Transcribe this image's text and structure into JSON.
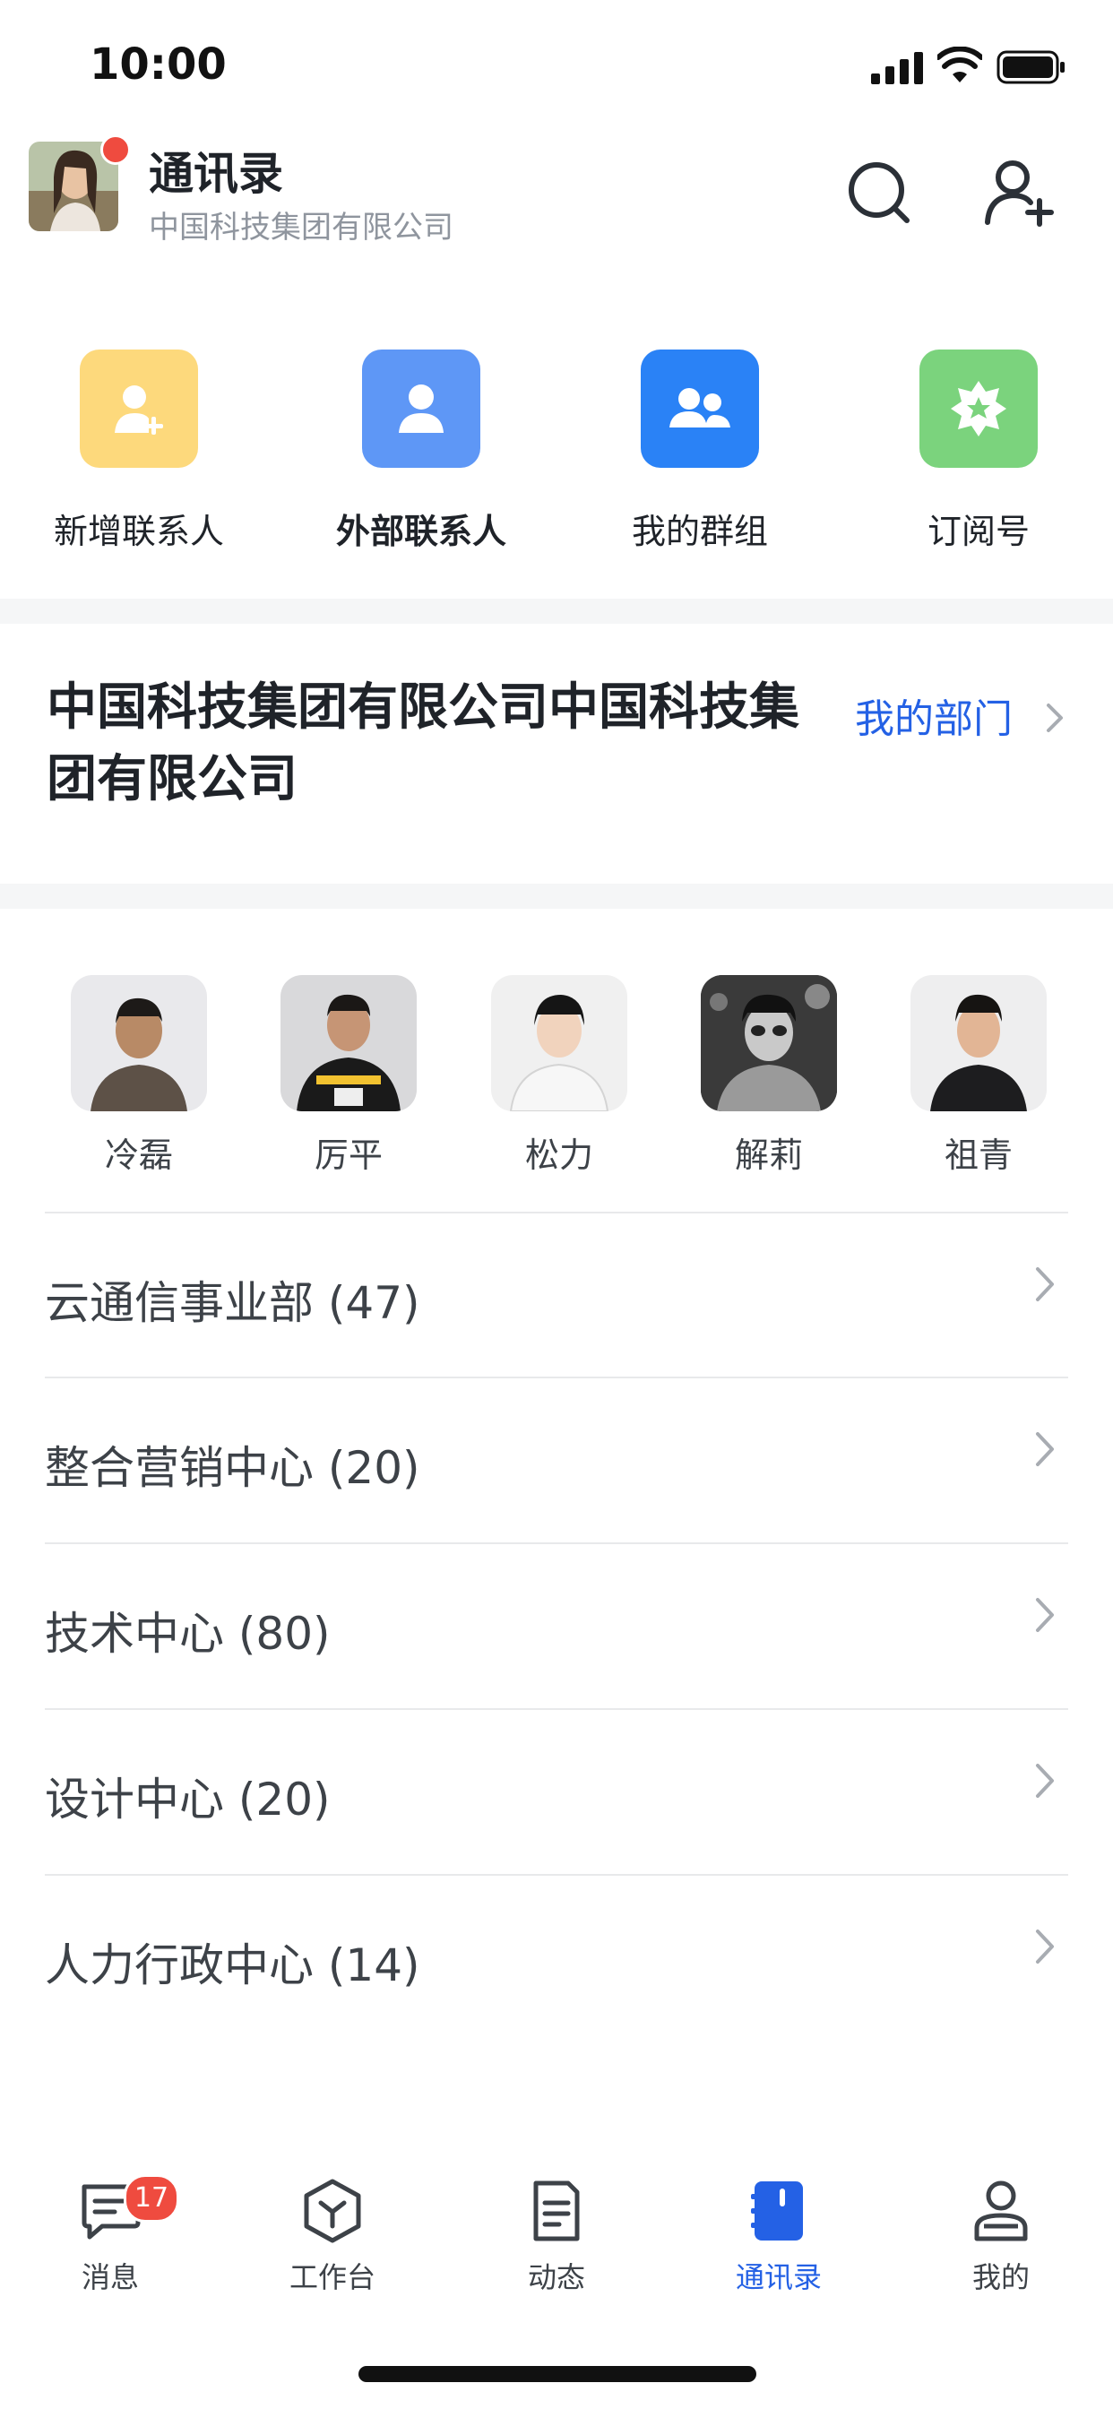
{
  "status_bar": {
    "time": "10:00"
  },
  "header": {
    "title": "通讯录",
    "subtitle": "中国科技集团有限公司"
  },
  "quick_actions": [
    {
      "label": "新增联系人",
      "color": "#fdd97c",
      "icon": "add-contact-icon"
    },
    {
      "label": "外部联系人",
      "color": "#5e97f6",
      "icon": "person-icon"
    },
    {
      "label": "我的群组",
      "color": "#2a82f6",
      "icon": "group-icon"
    },
    {
      "label": "订阅号",
      "color": "#7bd37d",
      "icon": "star-badge-icon"
    }
  ],
  "company": {
    "name": "中国科技集团有限公司中国科技集团有限公司",
    "my_department": "我的部门"
  },
  "members": [
    {
      "name": "冷磊"
    },
    {
      "name": "厉平"
    },
    {
      "name": "松力"
    },
    {
      "name": "解莉"
    },
    {
      "name": "祖青"
    }
  ],
  "departments": [
    {
      "label": "云通信事业部 (47)"
    },
    {
      "label": "整合营销中心 (20)"
    },
    {
      "label": "技术中心 (80)"
    },
    {
      "label": "设计中心 (20)"
    },
    {
      "label": "人力行政中心 (14)"
    }
  ],
  "tabs": [
    {
      "label": "消息",
      "badge": "17"
    },
    {
      "label": "工作台"
    },
    {
      "label": "动态"
    },
    {
      "label": "通讯录",
      "active": true
    },
    {
      "label": "我的"
    }
  ],
  "colors": {
    "accent": "#2461e5",
    "badge": "#ef4b3f",
    "text": "#1f2329"
  }
}
